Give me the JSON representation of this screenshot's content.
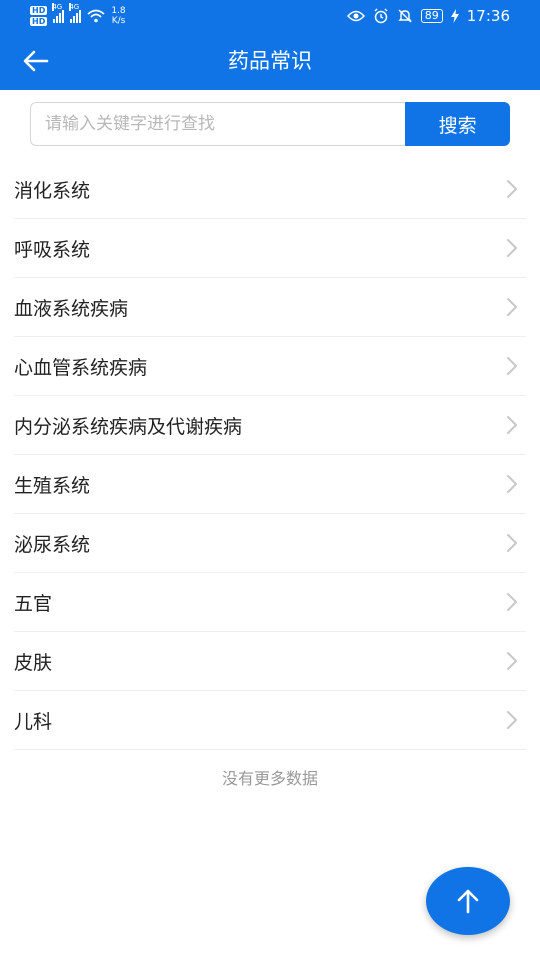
{
  "status_bar": {
    "network_left": "HD",
    "network_right": "HD",
    "signal_1": "4G",
    "signal_2": "4G",
    "speed_value": "1.8",
    "speed_unit": "K/s",
    "battery": "89",
    "time": "17:36"
  },
  "header": {
    "title": "药品常识"
  },
  "search": {
    "placeholder": "请输入关键字进行查找",
    "value": "",
    "button_label": "搜索"
  },
  "categories": [
    {
      "label": "消化系统"
    },
    {
      "label": "呼吸系统"
    },
    {
      "label": "血液系统疾病"
    },
    {
      "label": "心血管系统疾病"
    },
    {
      "label": "内分泌系统疾病及代谢疾病"
    },
    {
      "label": "生殖系统"
    },
    {
      "label": "泌尿系统"
    },
    {
      "label": "五官"
    },
    {
      "label": "皮肤"
    },
    {
      "label": "儿科"
    }
  ],
  "footer": {
    "no_more": "没有更多数据"
  },
  "colors": {
    "primary": "#1174e6",
    "divider": "#eeeeee",
    "muted_text": "#999999"
  },
  "icons": {
    "back": "arrow-left-icon",
    "chevron": "chevron-right-icon",
    "fab": "arrow-up-icon"
  }
}
